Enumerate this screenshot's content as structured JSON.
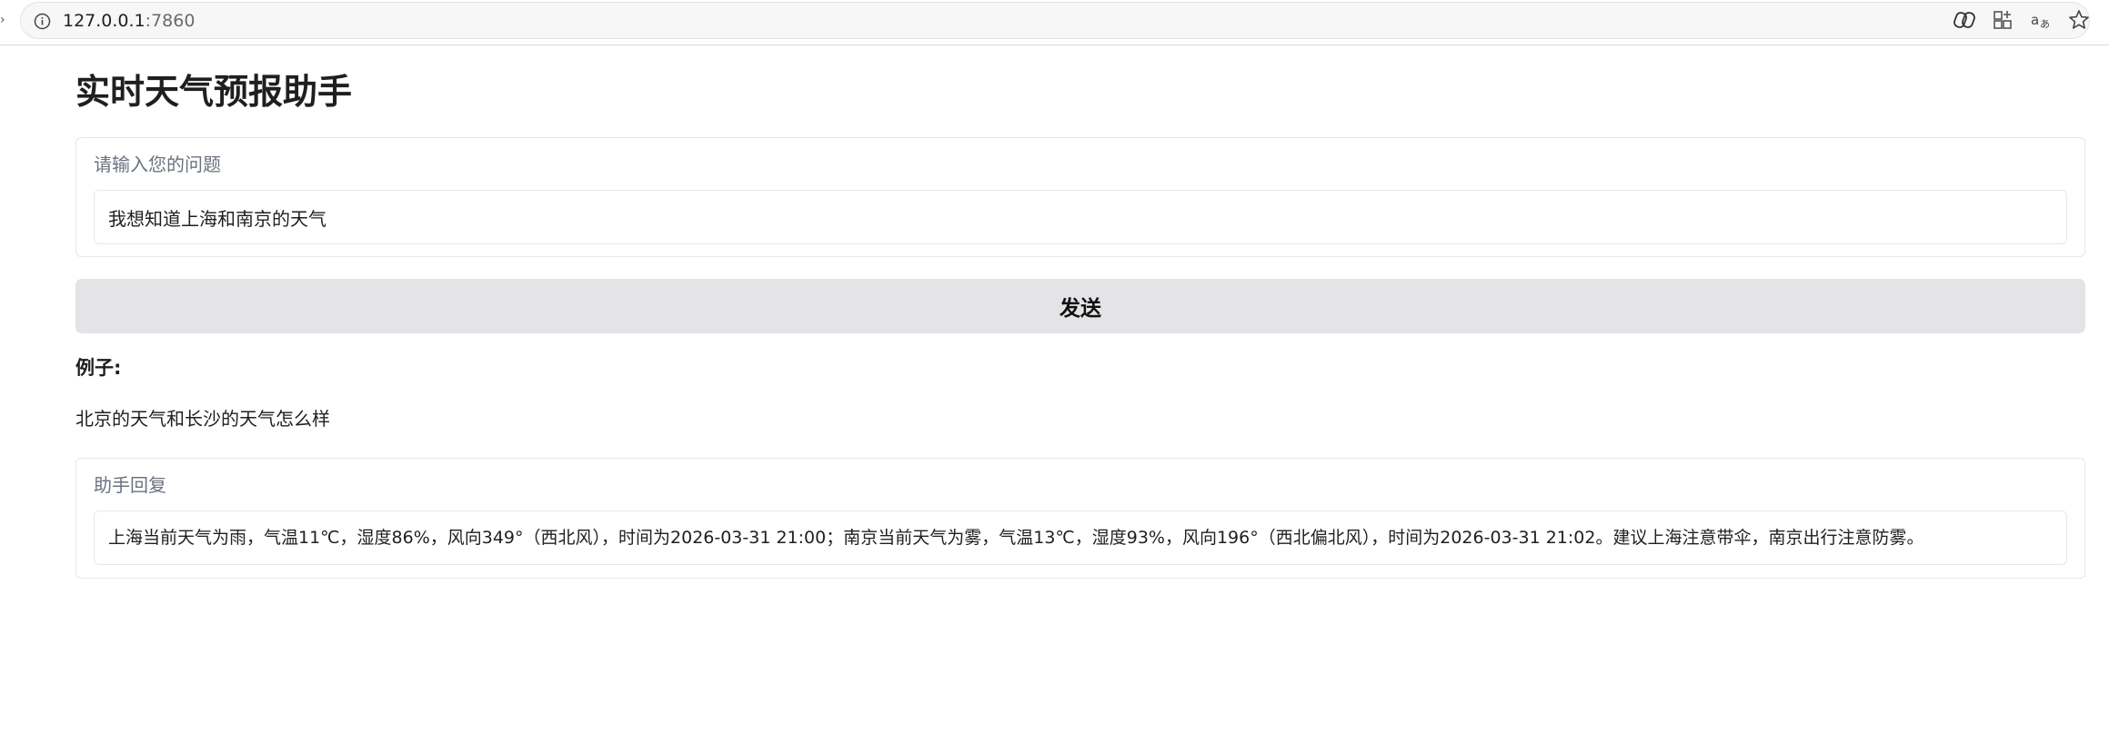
{
  "browser": {
    "url_host": "127.0.0.1",
    "url_port": ":7860"
  },
  "app": {
    "title": "实时天气预报助手"
  },
  "question": {
    "label": "请输入您的问题",
    "value": "我想知道上海和南京的天气"
  },
  "send_button": {
    "label": "发送"
  },
  "examples": {
    "heading": "例子:",
    "items": [
      "北京的天气和长沙的天气怎么样"
    ]
  },
  "reply": {
    "label": "助手回复",
    "value": "上海当前天气为雨，气温11℃，湿度86%，风向349°（西北风），时间为2026-03-31 21:00；南京当前天气为雾，气温13℃，湿度93%，风向196°（西北偏北风），时间为2026-03-31 21:02。建议上海注意带伞，南京出行注意防雾。"
  },
  "icons": {
    "address_bar": "info-icon",
    "toolbar": [
      "copilot-icon",
      "extensions-icon",
      "read-aloud-icon",
      "favorite-star-icon"
    ]
  }
}
